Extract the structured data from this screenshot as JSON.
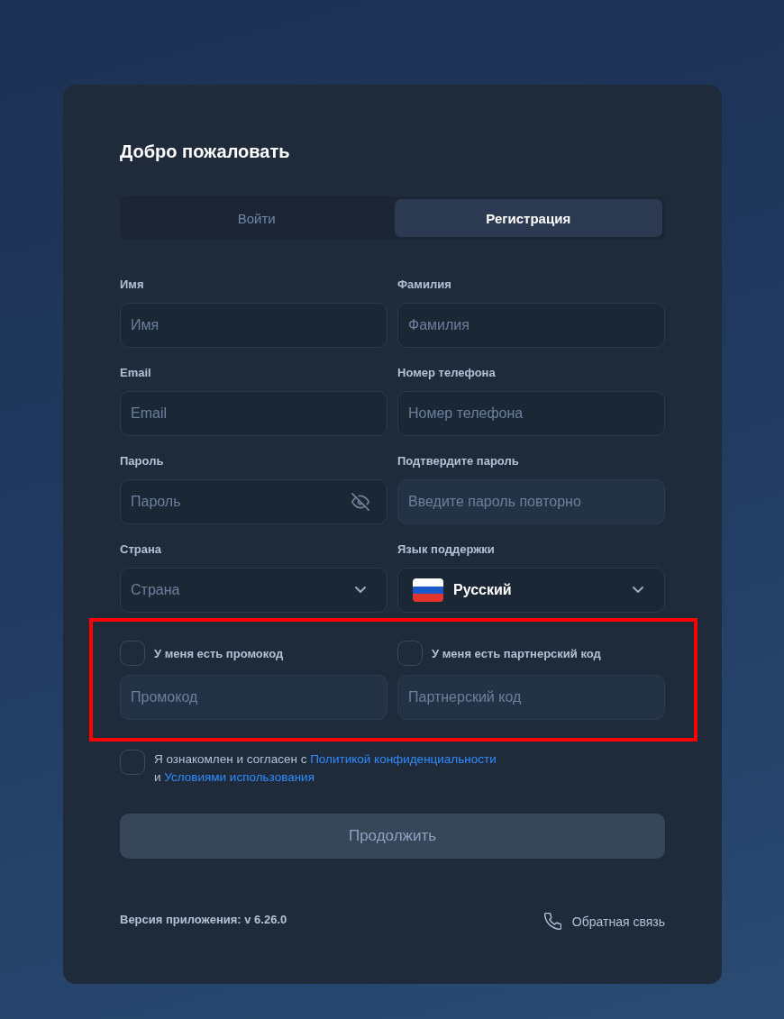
{
  "card": {
    "title": "Добро пожаловать"
  },
  "tabs": [
    {
      "label": "Войти",
      "selected": false
    },
    {
      "label": "Регистрация",
      "selected": true
    }
  ],
  "fields": [
    {
      "kind": "text",
      "label": "Имя",
      "placeholder": "Имя",
      "disabled": false
    },
    {
      "kind": "text",
      "label": "Фамилия",
      "placeholder": "Фамилия",
      "disabled": false
    },
    {
      "kind": "text",
      "label": "Email",
      "placeholder": "Email",
      "disabled": false
    },
    {
      "kind": "text",
      "label": "Номер телефона",
      "placeholder": "Номер телефона",
      "disabled": false
    },
    {
      "kind": "password",
      "label": "Пароль",
      "placeholder": "Пароль",
      "disabled": false
    },
    {
      "kind": "text",
      "label": "Подтвердите пароль",
      "placeholder": "Введите пароль повторно",
      "disabled": true
    },
    {
      "kind": "select",
      "label": "Страна",
      "placeholder": "Страна",
      "disabled": false
    },
    {
      "kind": "language",
      "label": "Язык поддержки",
      "value": "Русский",
      "disabled": false
    }
  ],
  "codes": {
    "highlighted": true,
    "items": [
      {
        "label": "У меня есть промокод",
        "checked": false,
        "placeholder": "Промокод",
        "disabled": true
      },
      {
        "label": "У меня есть партнерский код",
        "checked": false,
        "placeholder": "Партнерский код",
        "disabled": true
      }
    ]
  },
  "agreement": {
    "checked": false,
    "lines": [
      [
        {
          "kind": "text",
          "text": "Я ознакомлен и согласен с"
        },
        {
          "kind": "link",
          "text": "Политикой конфиденциальности"
        }
      ],
      [
        {
          "kind": "text",
          "text": "и"
        },
        {
          "kind": "link",
          "text": "Условиями использования"
        }
      ]
    ]
  },
  "submit": {
    "label": "Продолжить",
    "disabled": true
  },
  "footer": {
    "version": "Версия приложения: v 6.26.0",
    "feedback": "Обратная связь"
  }
}
